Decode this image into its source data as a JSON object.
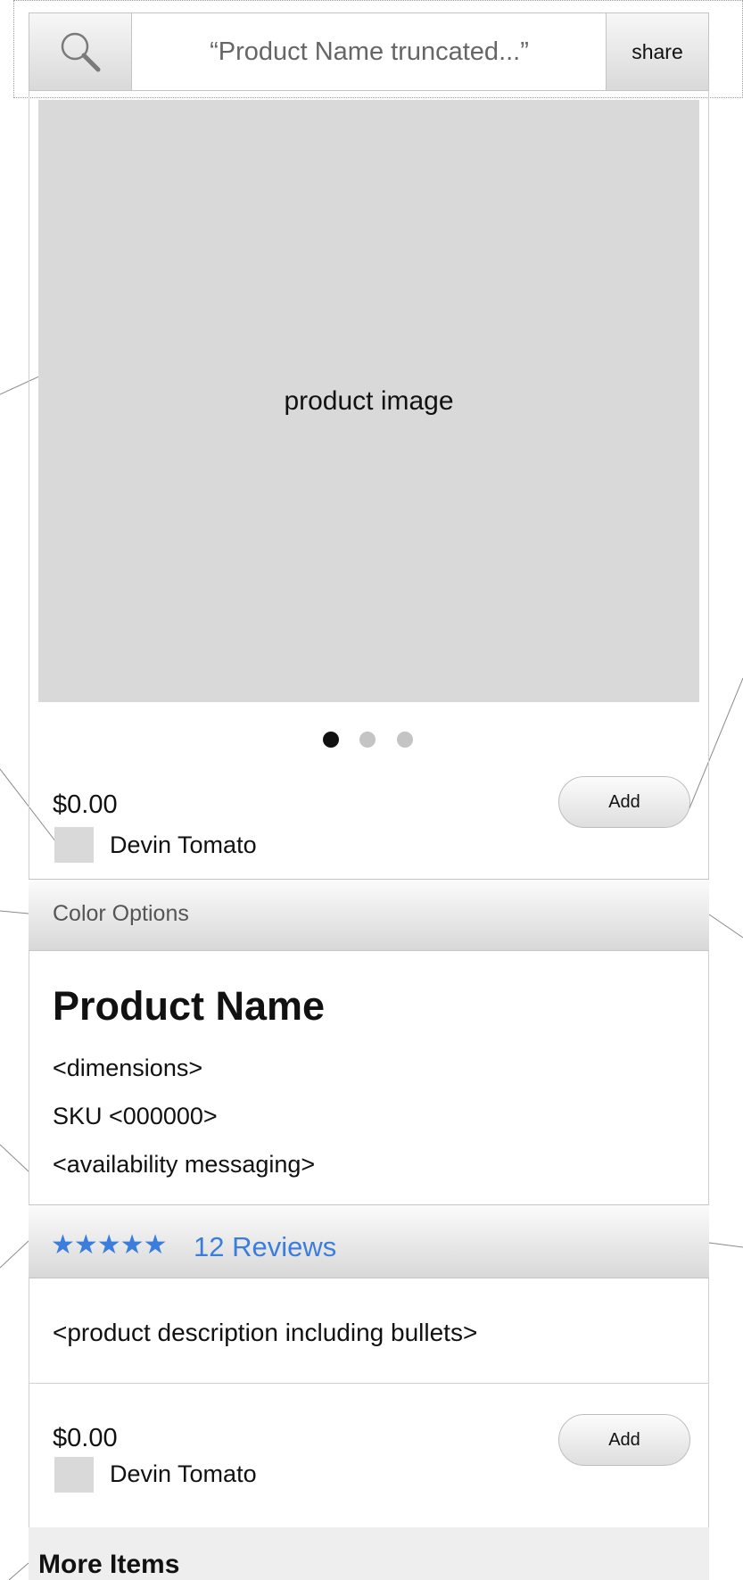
{
  "header": {
    "search_icon": "search-icon",
    "title": "“Product Name truncated...”",
    "share_label": "share"
  },
  "image": {
    "placeholder_label": "product image",
    "carousel": {
      "count": 3,
      "active_index": 0
    }
  },
  "purchase_top": {
    "price": "$0.00",
    "seller": "Devin Tomato",
    "add_label": "Add"
  },
  "color_options": {
    "label": "Color Options"
  },
  "product": {
    "name": "Product Name",
    "dimensions": "<dimensions>",
    "sku": "SKU <000000>",
    "availability": "<availability messaging>"
  },
  "reviews": {
    "stars": "★★★★★",
    "rating": 5,
    "label": "12 Reviews"
  },
  "description": {
    "text": "<product description including bullets>"
  },
  "purchase_bottom": {
    "price": "$0.00",
    "seller": "Devin Tomato",
    "add_label": "Add"
  },
  "more_items": {
    "title": "More Items"
  },
  "colors": {
    "link_blue": "#3b7ddd",
    "placeholder_gray": "#d9d9d9",
    "active_dot": "#111111",
    "inactive_dot": "#c4c4c4"
  }
}
